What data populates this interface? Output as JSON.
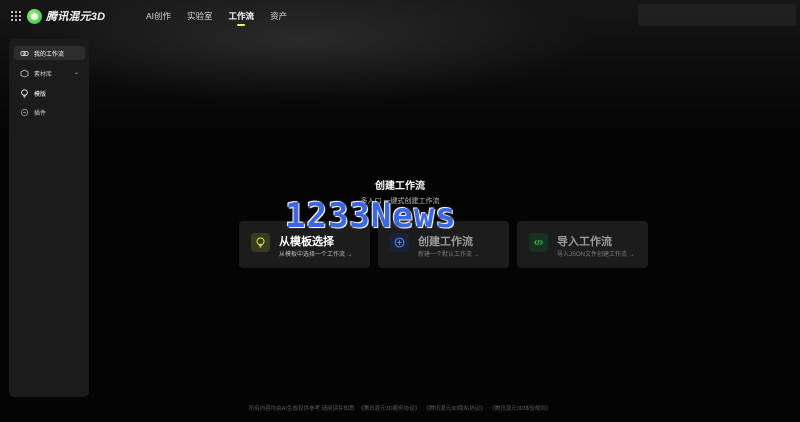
{
  "header": {
    "logo_text": "腾讯混元3D",
    "nav": [
      "AI创作",
      "实验室",
      "工作流",
      "资产"
    ],
    "active_nav": "工作流"
  },
  "sidebar": {
    "items": [
      {
        "label": "我的工作流",
        "icon": "workflow-icon",
        "active": true
      },
      {
        "label": "素材库",
        "icon": "cube-icon",
        "expandable": true
      },
      {
        "label": "模版",
        "icon": "lightbulb-icon"
      },
      {
        "label": "插件",
        "icon": "plugin-icon"
      }
    ]
  },
  "main": {
    "title": "创建工作流",
    "subtitle": "多入口 一键式创建工作流",
    "cards": [
      {
        "title": "从模板选择",
        "desc": "从模板中选择一个工作流 →",
        "icon": "lightbulb-icon",
        "icon_color": "#e3e74a"
      },
      {
        "title": "创建工作流",
        "desc": "新建一个默认工作流 →",
        "icon": "plus-circle-icon",
        "icon_color": "#5a8cff"
      },
      {
        "title": "导入工作流",
        "desc": "导入JSON文件创建工作流 →",
        "icon": "code-icon",
        "icon_color": "#3fcf6a"
      }
    ]
  },
  "watermark": "1233News",
  "footer": {
    "text": "所有内容均由AI生成仅供参考 请阅读并知悉",
    "links": [
      "《腾讯混元3D服务协议》",
      "《腾讯混元3D隐私协议》",
      "《腾讯混元3D体验规则》"
    ]
  },
  "colors": {
    "accent": "#e7f46a",
    "background": "#040404",
    "panel": "#1b1b1b"
  }
}
